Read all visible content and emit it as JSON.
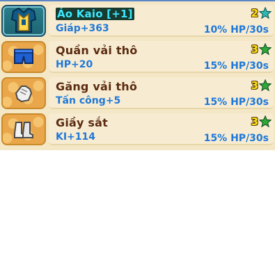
{
  "items": [
    {
      "name": "Áo Kaio [+1]",
      "stat": "Giáp+363",
      "level": "2",
      "regen": "10% HP/30s",
      "icon": "armor-icon",
      "selected": true
    },
    {
      "name": "Quần vải thô",
      "stat": "HP+20",
      "level": "3",
      "regen": "15% HP/30s",
      "icon": "pants-icon",
      "selected": false
    },
    {
      "name": "Găng vải thô",
      "stat": "Tấn công+5",
      "level": "3",
      "regen": "15% HP/30s",
      "icon": "glove-icon",
      "selected": false
    },
    {
      "name": "Giầy sắt",
      "stat": "KI+114",
      "level": "3",
      "regen": "15% HP/30s",
      "icon": "boots-icon",
      "selected": false
    }
  ],
  "colors": {
    "name": "#5b2c12",
    "stat": "#1f78d8",
    "level": "#ffe11a",
    "star_teal": "#2fb7b0",
    "star_green": "#2fa83a",
    "slot": "#e9a64a",
    "selected_slot": "#2a7f8c"
  }
}
